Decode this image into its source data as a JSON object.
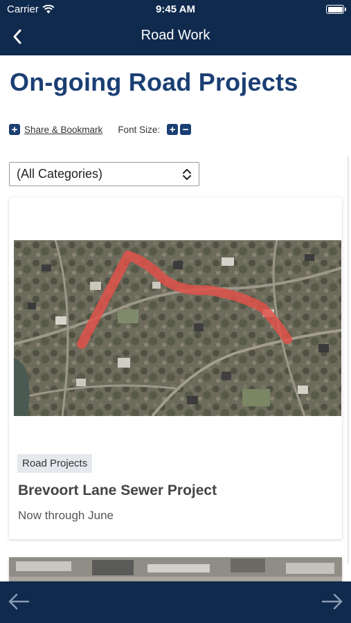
{
  "status_bar": {
    "carrier": "Carrier",
    "time": "9:45 AM"
  },
  "header": {
    "title": "Road Work",
    "back_icon": "chevron-left-icon"
  },
  "page": {
    "title": "On-going Road Projects",
    "share_label": "Share & Bookmark",
    "font_size_label": "Font Size:",
    "category_select": {
      "selected": "(All Categories)"
    }
  },
  "cards": [
    {
      "image": "aerial-map-image",
      "tag": "Road Projects",
      "title": "Brevoort Lane Sewer Project",
      "subtitle": "Now through June"
    }
  ],
  "colors": {
    "nav_bg": "#0f2a4d",
    "title_blue": "#1b3f73",
    "route_red": "#e0524a"
  },
  "bottom_bar": {
    "back_icon": "arrow-left-icon",
    "forward_icon": "arrow-right-icon"
  }
}
